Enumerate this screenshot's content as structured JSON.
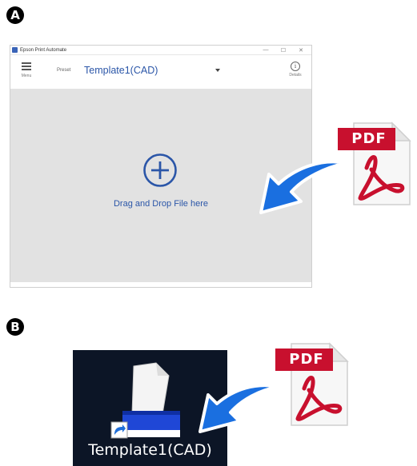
{
  "markers": {
    "a": "A",
    "b": "B"
  },
  "window": {
    "title": "Epson Print Automate",
    "controls": {
      "minimize": "—",
      "maximize": "☐",
      "close": "✕"
    },
    "menu_label": "Menu",
    "preset_label": "Preset",
    "preset_value": "Template1(CAD)",
    "details_label": "Details",
    "details_glyph": "i",
    "drop_text": "Drag and Drop File here"
  },
  "pdf_label": "PDF",
  "desktop": {
    "shortcut_label": "Template1(CAD)"
  },
  "colors": {
    "accent": "#2b56a8",
    "arrow": "#1a6fe0",
    "pdf_red": "#c8102e",
    "drop_area": "#e2e2e2",
    "desktop_bg": "#0c1526"
  }
}
